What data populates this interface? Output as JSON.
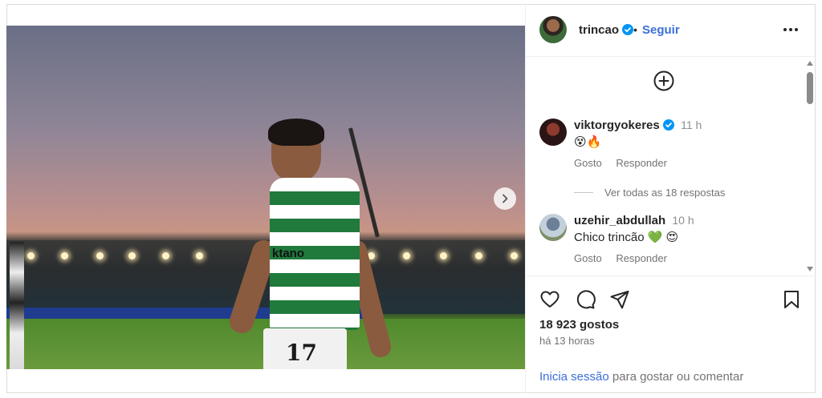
{
  "post": {
    "author": "trincao",
    "follow_label": "Seguir",
    "separator": "•",
    "more_icon": "more-horizontal-icon"
  },
  "comments": [
    {
      "user": "viktorgyokeres",
      "time": "11 h",
      "text": "😵🔥",
      "like_label": "Gosto",
      "reply_label": "Responder",
      "verified": true
    },
    {
      "user": "uzehir_abdullah",
      "time": "10 h",
      "text": "Chico trincão 💚 😍",
      "like_label": "Gosto",
      "reply_label": "Responder",
      "verified": false
    }
  ],
  "view_replies": "Ver todas as 18 respostas",
  "stats": {
    "likes": "18 923 gostos",
    "posted": "há 13 horas"
  },
  "footer": {
    "login_link": "Inicia sessão",
    "login_rest": " para gostar ou comentar"
  },
  "media": {
    "sponsor": "ktano",
    "shirt_number": "17"
  },
  "colors": {
    "link_blue": "#3a6fd8",
    "verified_blue": "#0095f6",
    "sporting_green": "#1f7a3c"
  }
}
